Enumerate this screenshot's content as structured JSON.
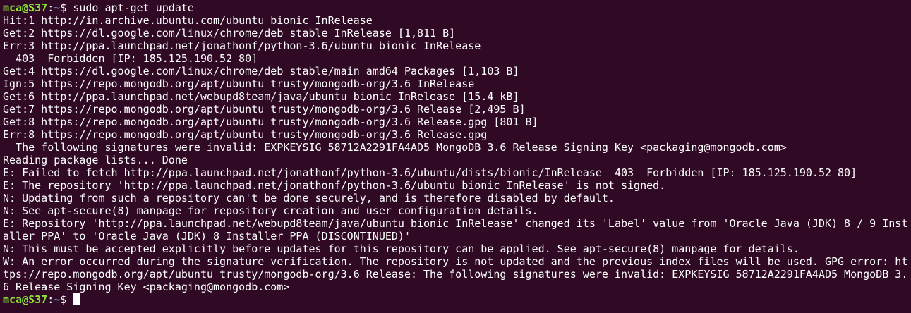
{
  "terminal": {
    "prompt_1": {
      "user_host": "mca@S37",
      "separator": ":",
      "path": "~",
      "symbol": "$ ",
      "command": "sudo apt-get update"
    },
    "output": [
      "Hit:1 http://in.archive.ubuntu.com/ubuntu bionic InRelease",
      "Get:2 https://dl.google.com/linux/chrome/deb stable InRelease [1,811 B]",
      "Err:3 http://ppa.launchpad.net/jonathonf/python-3.6/ubuntu bionic InRelease",
      "  403  Forbidden [IP: 185.125.190.52 80]",
      "Get:4 https://dl.google.com/linux/chrome/deb stable/main amd64 Packages [1,103 B]",
      "Ign:5 https://repo.mongodb.org/apt/ubuntu trusty/mongodb-org/3.6 InRelease",
      "Get:6 http://ppa.launchpad.net/webupd8team/java/ubuntu bionic InRelease [15.4 kB]",
      "Get:7 https://repo.mongodb.org/apt/ubuntu trusty/mongodb-org/3.6 Release [2,495 B]",
      "Get:8 https://repo.mongodb.org/apt/ubuntu trusty/mongodb-org/3.6 Release.gpg [801 B]",
      "Err:8 https://repo.mongodb.org/apt/ubuntu trusty/mongodb-org/3.6 Release.gpg",
      "  The following signatures were invalid: EXPKEYSIG 58712A2291FA4AD5 MongoDB 3.6 Release Signing Key <packaging@mongodb.com>",
      "Reading package lists... Done",
      "E: Failed to fetch http://ppa.launchpad.net/jonathonf/python-3.6/ubuntu/dists/bionic/InRelease  403  Forbidden [IP: 185.125.190.52 80]",
      "E: The repository 'http://ppa.launchpad.net/jonathonf/python-3.6/ubuntu bionic InRelease' is not signed.",
      "N: Updating from such a repository can't be done securely, and is therefore disabled by default.",
      "N: See apt-secure(8) manpage for repository creation and user configuration details.",
      "E: Repository 'http://ppa.launchpad.net/webupd8team/java/ubuntu bionic InRelease' changed its 'Label' value from 'Oracle Java (JDK) 8 / 9 Inst",
      "aller PPA' to 'Oracle Java (JDK) 8 Installer PPA (DISCONTINUED)'",
      "N: This must be accepted explicitly before updates for this repository can be applied. See apt-secure(8) manpage for details.",
      "W: An error occurred during the signature verification. The repository is not updated and the previous index files will be used. GPG error: ht",
      "tps://repo.mongodb.org/apt/ubuntu trusty/mongodb-org/3.6 Release: The following signatures were invalid: EXPKEYSIG 58712A2291FA4AD5 MongoDB 3.",
      "6 Release Signing Key <packaging@mongodb.com>"
    ],
    "prompt_2": {
      "user_host": "mca@S37",
      "separator": ":",
      "path": "~",
      "symbol": "$ "
    },
    "colors": {
      "background": "#300a24",
      "text": "#ffffff",
      "user_host": "#8ae234",
      "path": "#729fcf"
    }
  }
}
